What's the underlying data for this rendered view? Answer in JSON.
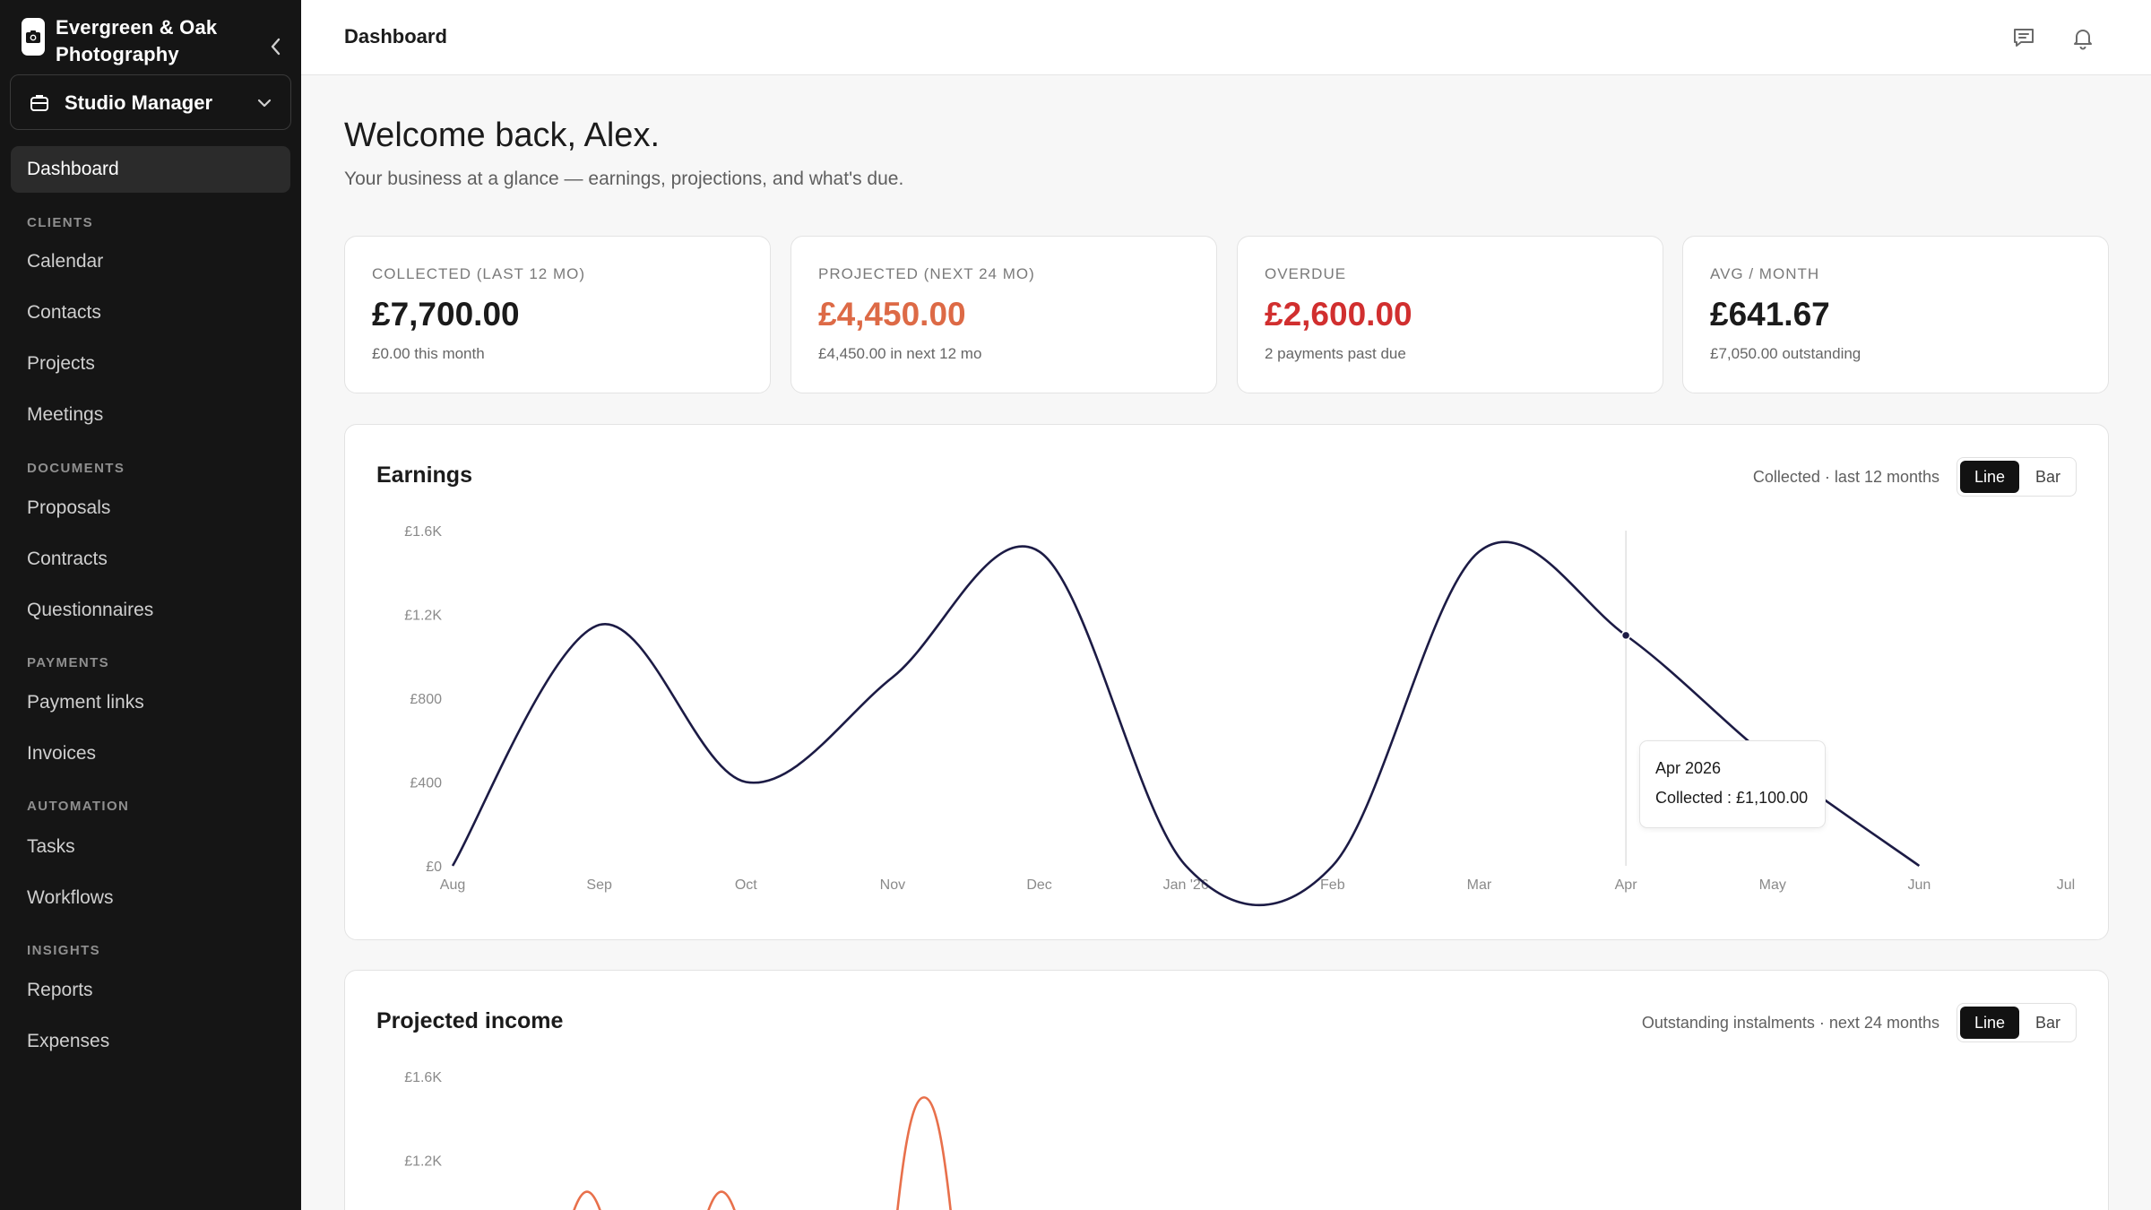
{
  "brand": {
    "name": "Evergreen & Oak Photography"
  },
  "workspace": {
    "label": "Studio Manager"
  },
  "nav": {
    "dashboard": "Dashboard",
    "sections": {
      "clients": "CLIENTS",
      "documents": "DOCUMENTS",
      "payments": "PAYMENTS",
      "automation": "AUTOMATION",
      "insights": "INSIGHTS"
    },
    "items": {
      "calendar": "Calendar",
      "contacts": "Contacts",
      "projects": "Projects",
      "meetings": "Meetings",
      "proposals": "Proposals",
      "contracts": "Contracts",
      "questionnaires": "Questionnaires",
      "payment_links": "Payment links",
      "invoices": "Invoices",
      "tasks": "Tasks",
      "workflows": "Workflows",
      "reports": "Reports",
      "expenses": "Expenses"
    }
  },
  "header": {
    "title": "Dashboard",
    "icons": [
      "message-icon",
      "bell-icon"
    ]
  },
  "welcome": {
    "title": "Welcome back, Alex.",
    "subtitle": "Your business at a glance — earnings, projections, and what's due."
  },
  "stats": [
    {
      "label": "COLLECTED (LAST 12 MO)",
      "value": "£7,700.00",
      "sub": "£0.00 this month",
      "color": "#1b1b1b"
    },
    {
      "label": "PROJECTED (NEXT 24 MO)",
      "value": "£4,450.00",
      "sub": "£4,450.00 in next 12 mo",
      "color": "#dd6a46"
    },
    {
      "label": "OVERDUE",
      "value": "£2,600.00",
      "sub": "2 payments past due",
      "color": "#d12f2f"
    },
    {
      "label": "AVG / MONTH",
      "value": "£641.67",
      "sub": "£7,050.00 outstanding",
      "color": "#1b1b1b"
    }
  ],
  "earnings": {
    "title": "Earnings",
    "meta": "Collected · last 12 months",
    "toggle": {
      "line": "Line",
      "bar": "Bar",
      "selected": "Line"
    },
    "tooltip": {
      "title": "Apr 2026",
      "value": "Collected : £1,100.00"
    }
  },
  "projected": {
    "title": "Projected income",
    "meta": "Outstanding instalments · next 24 months",
    "toggle": {
      "line": "Line",
      "bar": "Bar",
      "selected": "Line"
    }
  },
  "colors": {
    "earnings_line": "#1c1b45",
    "projected_line": "#e8704b",
    "accent": "#121212"
  },
  "chart_data": [
    {
      "type": "line",
      "title": "Earnings",
      "x": [
        "Aug",
        "Sep",
        "Oct",
        "Nov",
        "Dec",
        "Jan '26",
        "Feb",
        "Mar",
        "Apr",
        "May",
        "Jun",
        "Jul"
      ],
      "series": [
        {
          "name": "Collected",
          "values": [
            0,
            1150,
            400,
            900,
            1500,
            0,
            0,
            1500,
            1100,
            500,
            0,
            null
          ]
        }
      ],
      "yticks": [
        "£0",
        "£400",
        "£800",
        "£1.2K",
        "£1.6K"
      ],
      "ylim": [
        0,
        1600
      ],
      "grid": false,
      "highlight": {
        "x": "Apr",
        "value": 1100
      }
    },
    {
      "type": "line",
      "title": "Projected income",
      "yticks": [
        "£1.2K",
        "£1.6K"
      ],
      "ylim": [
        0,
        1600
      ],
      "grid": false,
      "note": "partially visible"
    }
  ]
}
